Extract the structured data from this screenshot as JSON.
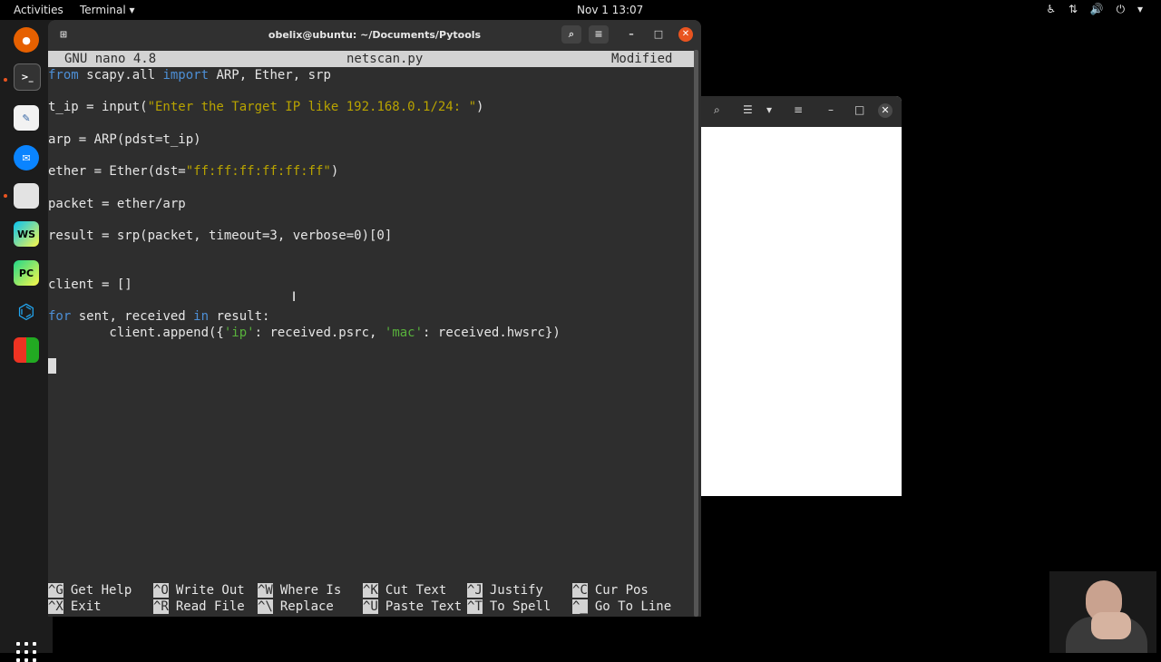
{
  "topbar": {
    "activities": "Activities",
    "app_menu": "Terminal ▾",
    "clock": "Nov 1  13:07",
    "tray_icons": [
      "accessibility-icon",
      "network-icon",
      "volume-icon",
      "power-icon"
    ]
  },
  "dock": {
    "items": [
      "firefox-icon",
      "terminal-icon",
      "text-editor-icon",
      "thunderbird-icon",
      "files-icon",
      "webstorm-icon",
      "pycharm-icon",
      "vscode-icon",
      "software-icon"
    ],
    "webstorm_label": "WS",
    "pycharm_label": "PC"
  },
  "terminal": {
    "title": "obelix@ubuntu: ~/Documents/Pytools"
  },
  "nano": {
    "version": "GNU nano 4.8",
    "filename": "netscan.py",
    "status": "Modified",
    "lines": {
      "l1_kw1": "from",
      "l1_mid": " scapy.all ",
      "l1_kw2": "import",
      "l1_rest": " ARP, Ether, srp",
      "l2_a": "t_ip = input(",
      "l2_str": "\"Enter the Target IP like 192.168.0.1/24: \"",
      "l2_b": ")",
      "l3": "arp = ARP(pdst=t_ip)",
      "l4_a": "ether = Ether(dst=",
      "l4_str": "\"ff:ff:ff:ff:ff:ff\"",
      "l4_b": ")",
      "l5": "packet = ether/arp",
      "l6": "result = srp(packet, timeout=3, verbose=0)[0]",
      "l7": "client = []",
      "l8_kw1": "for",
      "l8_mid": " sent, received ",
      "l8_kw2": "in",
      "l8_rest": " result:",
      "l9_a": "        client.append({",
      "l9_s1": "'ip'",
      "l9_b": ": received.psrc, ",
      "l9_s2": "'mac'",
      "l9_c": ": received.hwsrc})"
    }
  },
  "help": {
    "row1": [
      {
        "key": "^G",
        "label": "Get Help"
      },
      {
        "key": "^O",
        "label": "Write Out"
      },
      {
        "key": "^W",
        "label": "Where Is"
      },
      {
        "key": "^K",
        "label": "Cut Text"
      },
      {
        "key": "^J",
        "label": "Justify"
      },
      {
        "key": "^C",
        "label": "Cur Pos"
      }
    ],
    "row2": [
      {
        "key": "^X",
        "label": "Exit"
      },
      {
        "key": "^R",
        "label": "Read File"
      },
      {
        "key": "^\\",
        "label": "Replace"
      },
      {
        "key": "^U",
        "label": "Paste Text"
      },
      {
        "key": "^T",
        "label": "To Spell"
      },
      {
        "key": "^_",
        "label": "Go To Line"
      }
    ]
  }
}
